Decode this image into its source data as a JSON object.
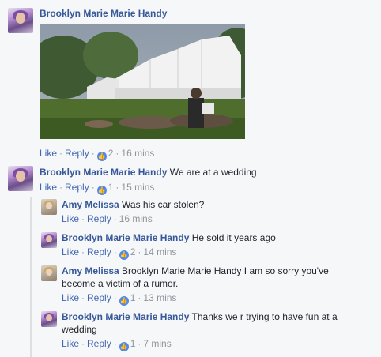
{
  "comments": [
    {
      "author": "Brooklyn Marie Marie Handy",
      "text": "",
      "has_photo": true,
      "actions": {
        "like": "Like",
        "reply": "Reply",
        "reactions": "2",
        "time": "16 mins"
      }
    },
    {
      "author": "Brooklyn Marie Marie Handy",
      "text": "We are at a wedding",
      "actions": {
        "like": "Like",
        "reply": "Reply",
        "reactions": "1",
        "time": "15 mins"
      }
    }
  ],
  "replies": [
    {
      "author": "Amy Melissa",
      "text": "Was his car stolen?",
      "actions": {
        "like": "Like",
        "reply": "Reply",
        "reactions": "",
        "time": "16 mins"
      }
    },
    {
      "author": "Brooklyn Marie Marie Handy",
      "text": "He sold it years ago",
      "actions": {
        "like": "Like",
        "reply": "Reply",
        "reactions": "2",
        "time": "14 mins"
      }
    },
    {
      "author": "Amy Melissa",
      "text_line1": "Brooklyn Marie Marie Handy I am so sorry you've",
      "text_line2": "become a victim of a rumor.",
      "actions": {
        "like": "Like",
        "reply": "Reply",
        "reactions": "1",
        "time": "13 mins"
      }
    },
    {
      "author": "Brooklyn Marie Marie Handy",
      "text_line1": "Thanks we r trying to have fun at a",
      "text_line2": "wedding",
      "actions": {
        "like": "Like",
        "reply": "Reply",
        "reactions": "1",
        "time": "7 mins"
      }
    }
  ],
  "icons": {
    "like_reaction": "thumbs-up-icon"
  },
  "colors": {
    "name": "#365899",
    "link": "#4267b2",
    "meta": "#90949c",
    "like_badge": "#4e88f5"
  }
}
